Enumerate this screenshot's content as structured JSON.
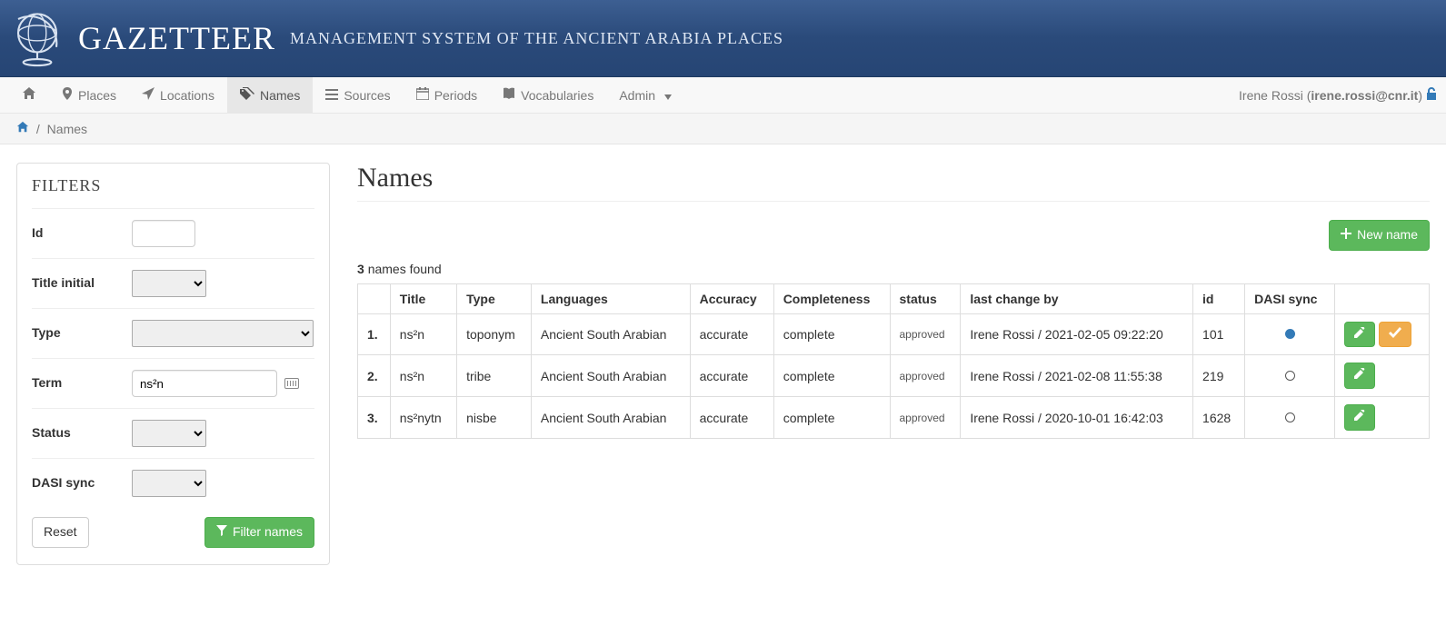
{
  "banner": {
    "title_main": "GAZETTEER",
    "title_sub": "MANAGEMENT SYSTEM OF THE ANCIENT ARABIA PLACES"
  },
  "nav": {
    "places": "Places",
    "locations": "Locations",
    "names": "Names",
    "sources": "Sources",
    "periods": "Periods",
    "vocabularies": "Vocabularies",
    "admin": "Admin"
  },
  "user": {
    "name": "Irene Rossi",
    "email": "irene.rossi@cnr.it"
  },
  "breadcrumb": {
    "current": "Names"
  },
  "filters": {
    "heading": "FILTERS",
    "labels": {
      "id": "Id",
      "title_initial": "Title initial",
      "type": "Type",
      "term": "Term",
      "status": "Status",
      "dasi_sync": "DASI sync"
    },
    "values": {
      "id": "",
      "title_initial": "",
      "type": "",
      "term": "ns²n",
      "status": "",
      "dasi_sync": ""
    },
    "buttons": {
      "reset": "Reset",
      "filter": "Filter names"
    }
  },
  "main": {
    "heading": "Names",
    "found_count": "3",
    "found_suffix": "names found",
    "new_button": "New name",
    "columns": {
      "title": "Title",
      "type": "Type",
      "languages": "Languages",
      "accuracy": "Accuracy",
      "completeness": "Completeness",
      "status": "status",
      "last_change": "last change by",
      "id": "id",
      "dasi_sync": "DASI sync"
    },
    "rows": [
      {
        "idx": "1.",
        "title": "ns²n",
        "type": "toponym",
        "languages": "Ancient South Arabian",
        "accuracy": "accurate",
        "completeness": "complete",
        "status": "approved",
        "last_change": "Irene Rossi / 2021-02-05 09:22:20",
        "id": "101",
        "sync": "filled",
        "has_approve": true
      },
      {
        "idx": "2.",
        "title": "ns²n",
        "type": "tribe",
        "languages": "Ancient South Arabian",
        "accuracy": "accurate",
        "completeness": "complete",
        "status": "approved",
        "last_change": "Irene Rossi / 2021-02-08 11:55:38",
        "id": "219",
        "sync": "empty",
        "has_approve": false
      },
      {
        "idx": "3.",
        "title": "ns²nytn",
        "type": "nisbe",
        "languages": "Ancient South Arabian",
        "accuracy": "accurate",
        "completeness": "complete",
        "status": "approved",
        "last_change": "Irene Rossi / 2020-10-01 16:42:03",
        "id": "1628",
        "sync": "empty",
        "has_approve": false
      }
    ]
  }
}
